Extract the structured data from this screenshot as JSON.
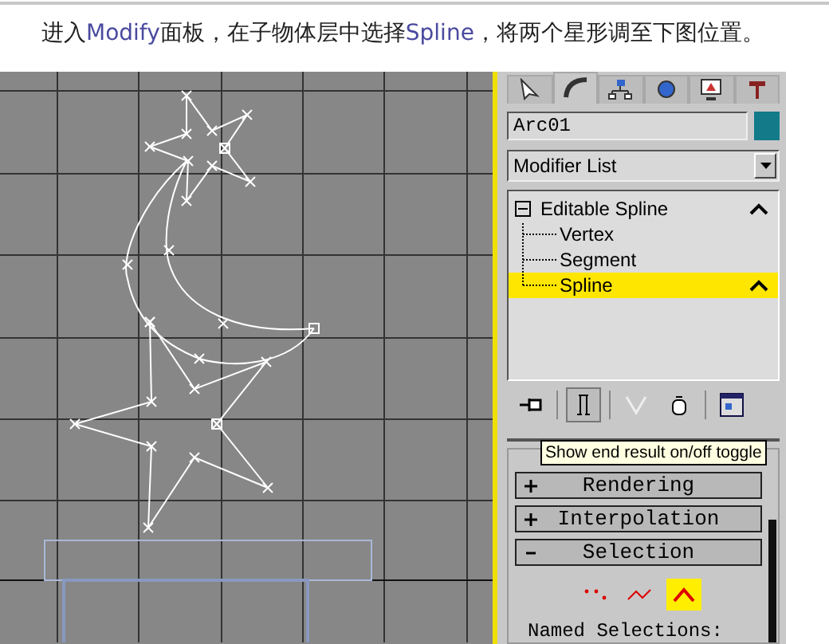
{
  "caption": [
    {
      "text": "进入",
      "kind": "plain"
    },
    {
      "text": "Modify",
      "kind": "term"
    },
    {
      "text": "面板，在子物体层中选择",
      "kind": "plain"
    },
    {
      "text": "Spline",
      "kind": "term"
    },
    {
      "text": "，将两个星形调至下图位置。",
      "kind": "plain"
    }
  ],
  "panel": {
    "tabs": [
      {
        "kind": "create",
        "selected": false
      },
      {
        "kind": "modify",
        "selected": true
      },
      {
        "kind": "hierarchy",
        "selected": false
      },
      {
        "kind": "motion",
        "selected": false
      },
      {
        "kind": "display",
        "selected": false
      },
      {
        "kind": "utilities",
        "selected": false
      }
    ],
    "object_name": "Arc01",
    "modifier_list": "Modifier List",
    "stack": [
      {
        "label": "Editable Spline",
        "expanded": true,
        "selected": false,
        "children": [
          {
            "label": "Vertex",
            "selected": false
          },
          {
            "label": "Segment",
            "selected": false
          },
          {
            "label": "Spline",
            "selected": true
          }
        ]
      }
    ],
    "toolbar": [
      {
        "kind": "pin",
        "pressed": false
      },
      {
        "kind": "end-result",
        "pressed": true
      },
      {
        "kind": "unique",
        "pressed": false
      },
      {
        "kind": "remove",
        "pressed": false
      },
      {
        "kind": "configure",
        "pressed": false
      }
    ],
    "tooltip": "Show end result on/off toggle",
    "rollouts": [
      {
        "title": "Rendering",
        "expanded": false
      },
      {
        "title": "Interpolation",
        "expanded": false
      },
      {
        "title": "Selection",
        "expanded": true
      }
    ],
    "selection_levels": [
      {
        "kind": "vertex",
        "selected": false
      },
      {
        "kind": "segment",
        "selected": false
      },
      {
        "kind": "spline",
        "selected": true
      }
    ],
    "named_selections": "Named Selections:"
  }
}
